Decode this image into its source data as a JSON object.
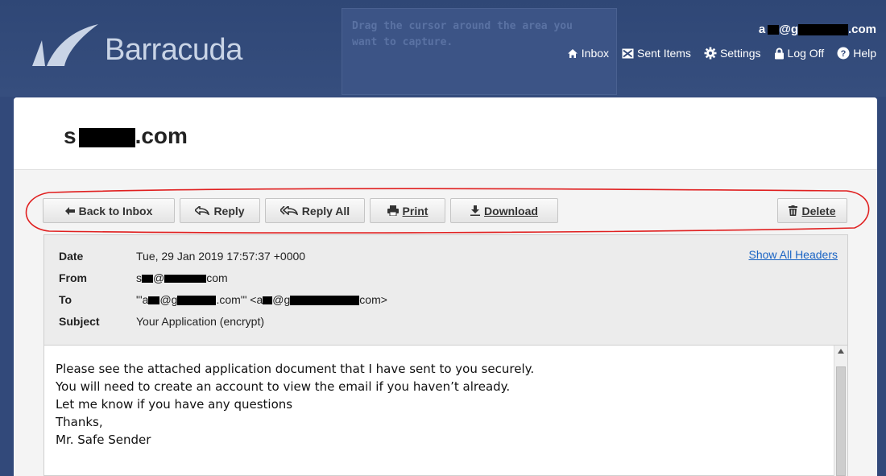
{
  "app": {
    "brand": "Barracuda"
  },
  "capture_hint": [
    "Drag the cursor around the area you",
    "want to capture."
  ],
  "user": {
    "email_prefix": "a",
    "email_mid": "@g",
    "email_suffix": ".com"
  },
  "nav": [
    {
      "label": "Inbox",
      "icon": "home-icon"
    },
    {
      "label": "Sent Items",
      "icon": "sent-icon"
    },
    {
      "label": "Settings",
      "icon": "gear-icon"
    },
    {
      "label": "Log Off",
      "icon": "lock-icon"
    },
    {
      "label": "Help",
      "icon": "help-icon"
    }
  ],
  "page": {
    "title_prefix": "s",
    "title_suffix": ".com"
  },
  "toolbar": {
    "back": "Back to Inbox",
    "reply": "Reply",
    "reply_all": "Reply All",
    "print": "Print",
    "download": "Download",
    "delete": "Delete"
  },
  "headers": {
    "date_label": "Date",
    "date": "Tue, 29 Jan 2019 17:57:37 +0000",
    "from_label": "From",
    "from_prefix": "s",
    "from_mid": "@",
    "from_suffix": "com",
    "to_label": "To",
    "to_part1": "\"'a",
    "to_part2": "@g",
    "to_part3": ".com'\" <a",
    "to_part4": "@g",
    "to_part5": "com>",
    "subject_label": "Subject",
    "subject": "Your Application (encrypt)",
    "show_all": "Show All Headers"
  },
  "body": {
    "lines": [
      "Please see the attached application document that I have sent to you securely.",
      "You will need to create an account to view the email if you haven’t already.",
      "Let me know if you have any questions",
      "Thanks,",
      "Mr. Safe Sender"
    ]
  },
  "colors": {
    "topbar": "#32497a",
    "link": "#1a64c4",
    "annotation": "#e02020"
  }
}
